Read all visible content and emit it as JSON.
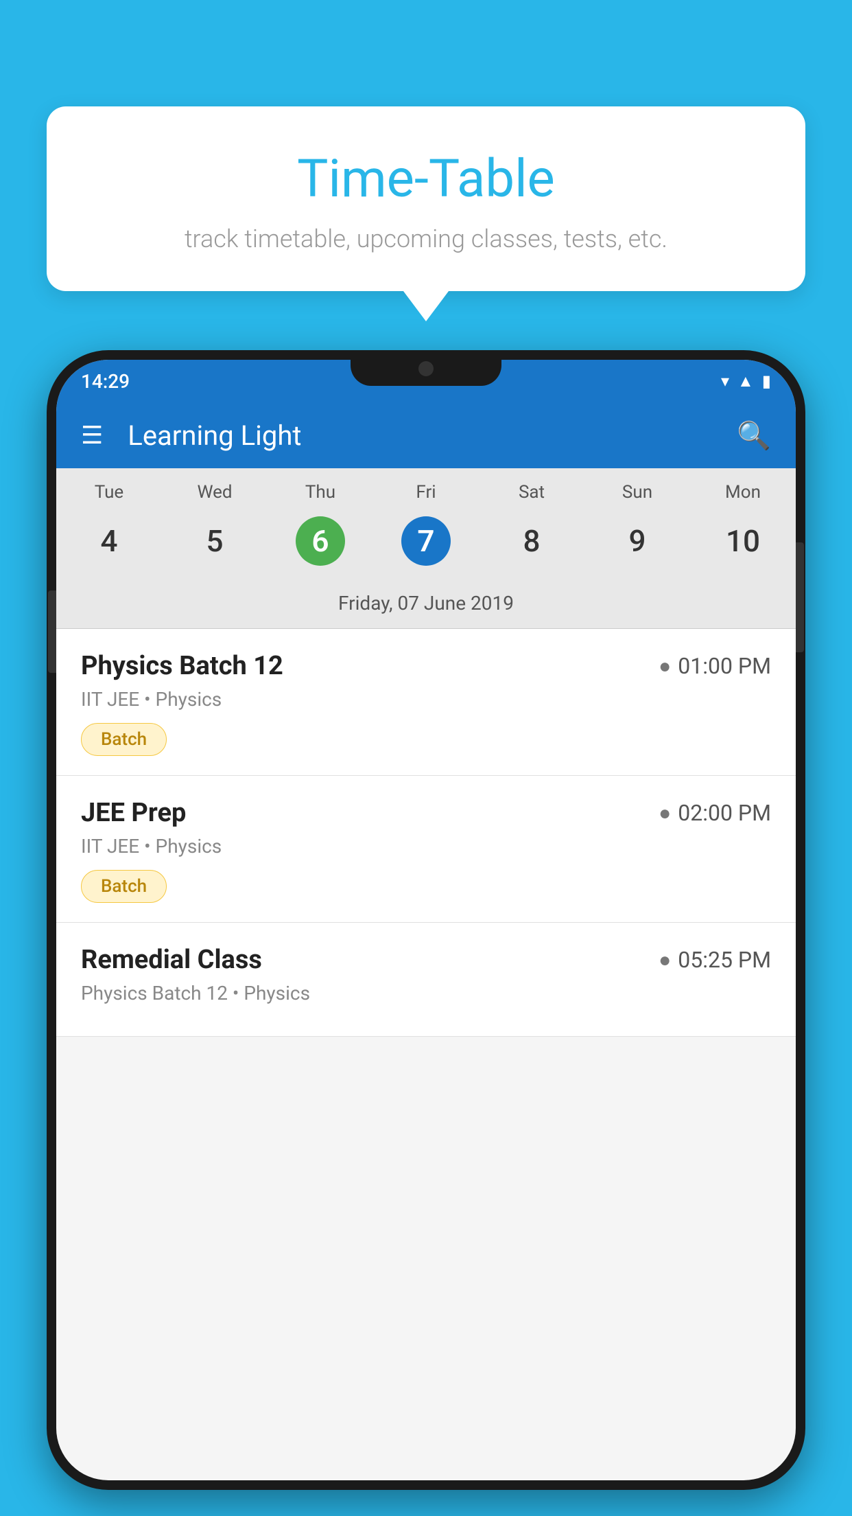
{
  "page": {
    "background_color": "#29B6E8"
  },
  "tooltip": {
    "title": "Time-Table",
    "subtitle": "track timetable, upcoming classes, tests, etc."
  },
  "phone": {
    "status_bar": {
      "time": "14:29"
    },
    "app_bar": {
      "title": "Learning Light"
    },
    "calendar": {
      "days": [
        {
          "label": "Tue",
          "num": "4"
        },
        {
          "label": "Wed",
          "num": "5"
        },
        {
          "label": "Thu",
          "num": "6",
          "state": "today"
        },
        {
          "label": "Fri",
          "num": "7",
          "state": "selected"
        },
        {
          "label": "Sat",
          "num": "8"
        },
        {
          "label": "Sun",
          "num": "9"
        },
        {
          "label": "Mon",
          "num": "10"
        }
      ],
      "selected_date_label": "Friday, 07 June 2019"
    },
    "schedule": [
      {
        "name": "Physics Batch 12",
        "time": "01:00 PM",
        "detail": "IIT JEE • Physics",
        "badge": "Batch"
      },
      {
        "name": "JEE Prep",
        "time": "02:00 PM",
        "detail": "IIT JEE • Physics",
        "badge": "Batch"
      },
      {
        "name": "Remedial Class",
        "time": "05:25 PM",
        "detail": "Physics Batch 12 • Physics",
        "badge": null
      }
    ]
  }
}
